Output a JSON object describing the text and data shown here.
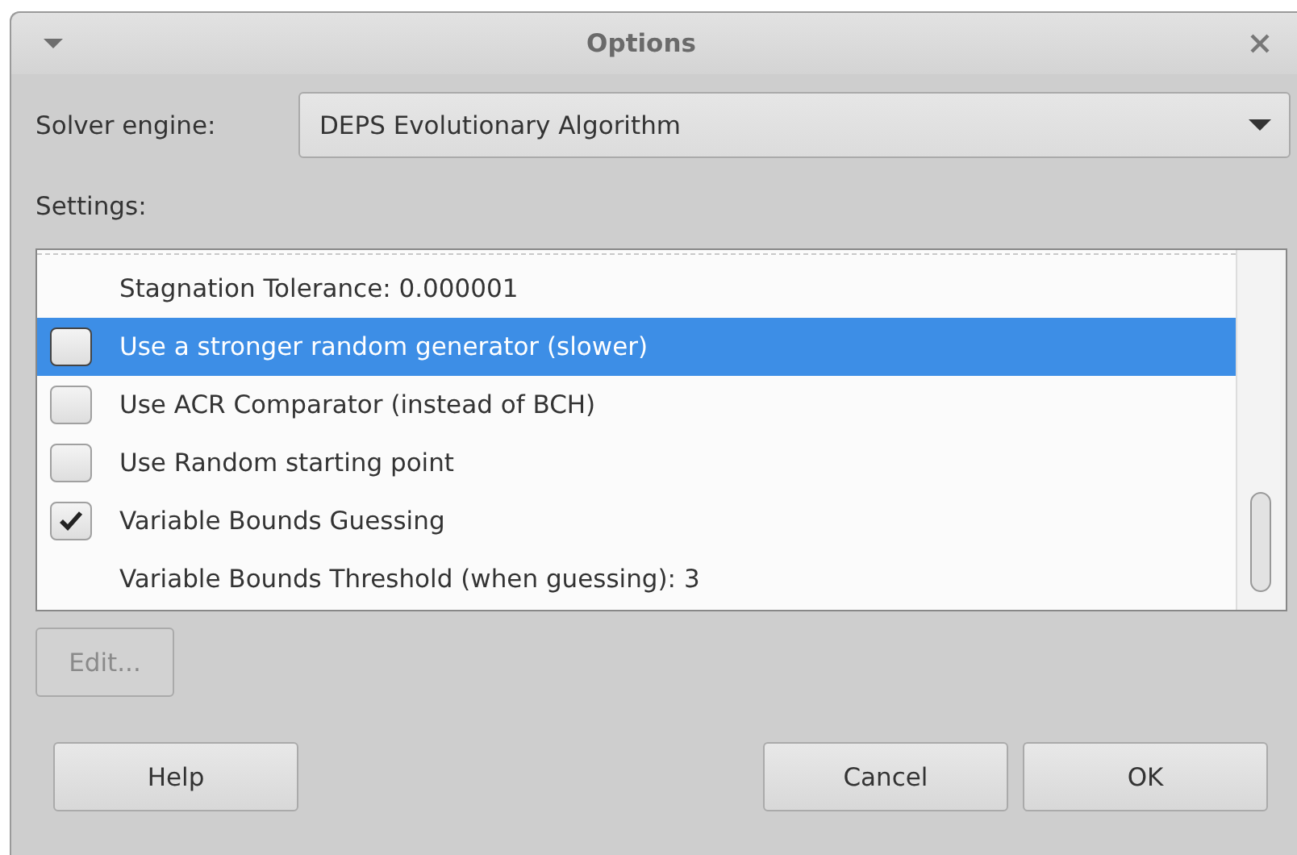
{
  "window": {
    "title": "Options"
  },
  "solver": {
    "label": "Solver engine:",
    "value": "DEPS Evolutionary Algorithm"
  },
  "settings": {
    "label": "Settings:",
    "items": [
      {
        "kind": "text",
        "label": "Stagnation Tolerance: 0.000001",
        "selected": false
      },
      {
        "kind": "checkbox",
        "label": "Use a stronger random generator (slower)",
        "checked": false,
        "selected": true
      },
      {
        "kind": "checkbox",
        "label": "Use ACR Comparator (instead of BCH)",
        "checked": false,
        "selected": false
      },
      {
        "kind": "checkbox",
        "label": "Use Random starting point",
        "checked": false,
        "selected": false
      },
      {
        "kind": "checkbox",
        "label": "Variable Bounds Guessing",
        "checked": true,
        "selected": false
      },
      {
        "kind": "text",
        "label": "Variable Bounds Threshold (when guessing): 3",
        "selected": false
      }
    ]
  },
  "edit_button": {
    "label": "Edit...",
    "disabled": true
  },
  "buttons": [
    {
      "label": "Help"
    },
    {
      "label": "Cancel"
    },
    {
      "label": "OK"
    }
  ]
}
